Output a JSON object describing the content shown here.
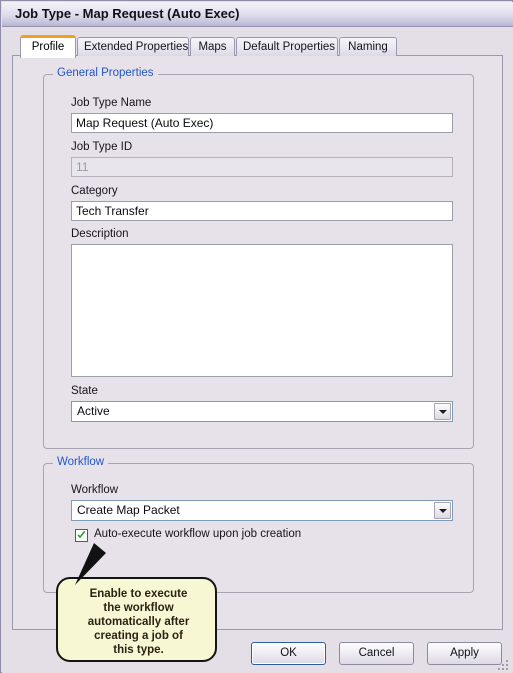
{
  "window": {
    "title": "Job Type - Map Request (Auto Exec)"
  },
  "tabs": [
    {
      "label": "Profile",
      "active": true
    },
    {
      "label": "Extended Properties",
      "active": false
    },
    {
      "label": "Maps",
      "active": false
    },
    {
      "label": "Default Properties",
      "active": false
    },
    {
      "label": "Naming",
      "active": false
    }
  ],
  "general_properties": {
    "group_label": "General Properties",
    "job_type_name": {
      "label": "Job Type Name",
      "value": "Map Request (Auto Exec)",
      "placeholder": ""
    },
    "job_type_id": {
      "label": "Job Type ID",
      "value": "11",
      "readonly": true
    },
    "category": {
      "label": "Category",
      "value": "Tech Transfer",
      "placeholder": ""
    },
    "description": {
      "label": "Description",
      "value": "",
      "placeholder": ""
    },
    "state": {
      "label": "State",
      "value": "Active",
      "options": [
        "Active"
      ]
    }
  },
  "workflow_group": {
    "group_label": "Workflow",
    "workflow": {
      "label": "Workflow",
      "value": "Create Map Packet",
      "options": [
        "Create Map Packet"
      ]
    },
    "auto_execute": {
      "label": "Auto-execute workflow upon job creation",
      "checked": true
    }
  },
  "callout": {
    "lines": [
      "Enable to execute",
      "the workflow",
      "automatically after",
      "creating a job of",
      "this type."
    ],
    "text": "Enable to execute the workflow automatically after creating a job of this type."
  },
  "buttons": {
    "ok": "OK",
    "cancel": "Cancel",
    "apply": "Apply"
  },
  "colors": {
    "accent_tab": "#f0a01e",
    "group_label": "#2155cc",
    "callout_bg": "#f8f7d4",
    "check_mark": "#1e9b1e",
    "dialog_bg": "#e4dfe7",
    "panel_bg": "#e7e2ea"
  },
  "icons": {
    "dropdown": "chevron-down-icon",
    "check": "check-icon",
    "grip": "resize-grip-icon"
  }
}
